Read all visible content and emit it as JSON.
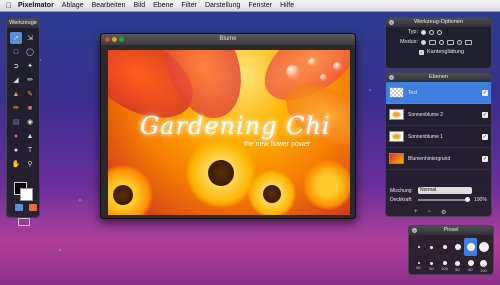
{
  "menubar": {
    "app_name": "Pixelmator",
    "items": [
      "Ablage",
      "Bearbeiten",
      "Bild",
      "Ebene",
      "Filter",
      "Darstellung",
      "Fenster",
      "Hilfe"
    ]
  },
  "tools_panel": {
    "title": "Werkzeuge"
  },
  "document": {
    "title": "Blume",
    "art_title": "Gardening Chi",
    "art_subtitle": "the new flower power"
  },
  "tool_options": {
    "title": "Werkzeug-Optionen",
    "typ_label": "Typ:",
    "modus_label": "Modus:",
    "antialias_label": "Kantenglättung"
  },
  "layers": {
    "title": "Ebenen",
    "items": [
      {
        "name": "Text",
        "selected": true
      },
      {
        "name": "Sonnenblume 2",
        "selected": false
      },
      {
        "name": "Sonnenblume 1",
        "selected": false
      },
      {
        "name": "Blumenhintergrund",
        "selected": false
      }
    ],
    "blend_label": "Mischung:",
    "blend_value": "Normal",
    "opacity_label": "Deckkraft:",
    "opacity_value": "100%"
  },
  "brushes": {
    "title": "Pinsel",
    "row1": [
      "",
      "",
      "",
      "",
      "",
      ""
    ],
    "row2": [
      "50",
      "50",
      "100",
      "50",
      "80",
      "100"
    ]
  },
  "colors": {
    "selection_blue": "#3e7fe0",
    "foreground": "#000000",
    "background": "#ffffff"
  }
}
